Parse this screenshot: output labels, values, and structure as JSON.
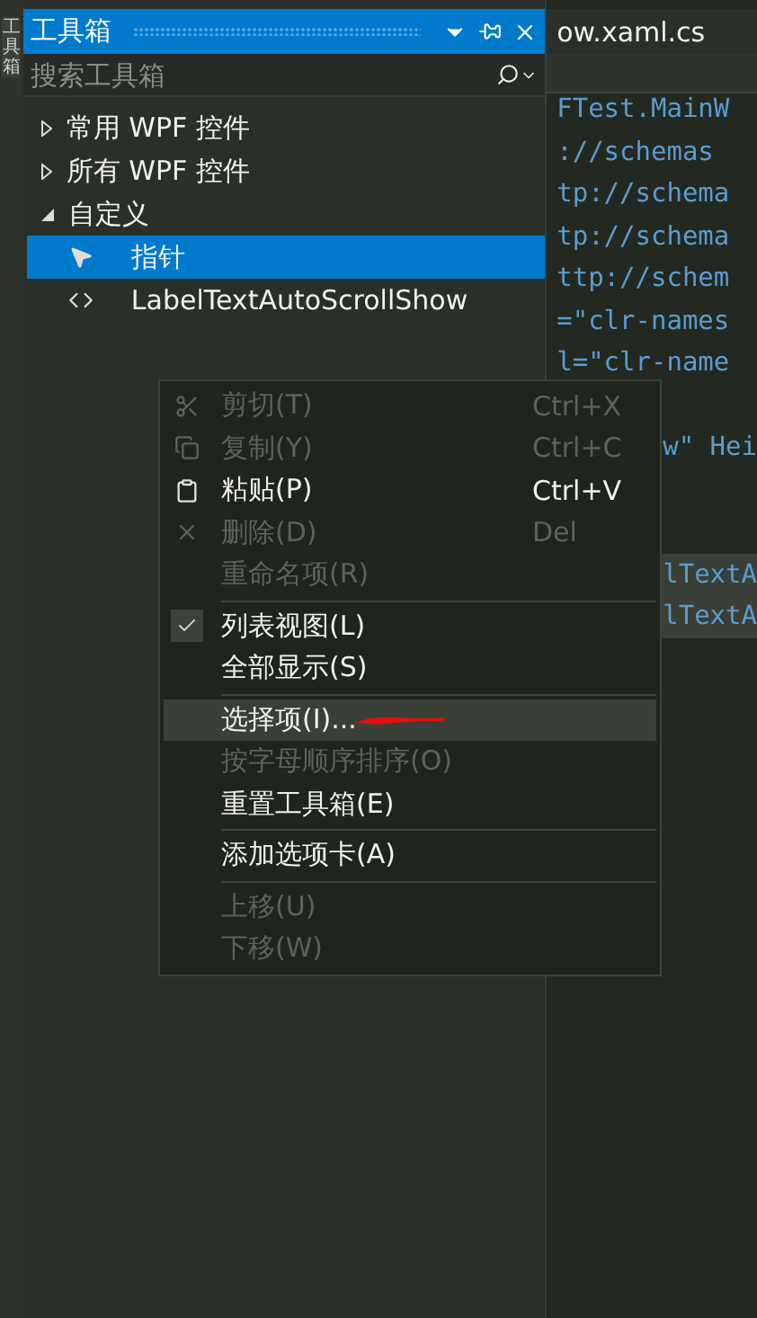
{
  "side_tab": {
    "label": "工具箱"
  },
  "toolbox": {
    "title": "工具箱",
    "search": {
      "placeholder": "搜索工具箱"
    },
    "tree": [
      {
        "label": "常用 WPF 控件",
        "expanded": false
      },
      {
        "label": "所有 WPF 控件",
        "expanded": false
      },
      {
        "label": "自定义",
        "expanded": true,
        "children": [
          {
            "label": "指针",
            "kind": "pointer",
            "selected": true
          },
          {
            "label": "LabelTextAutoScrollShow",
            "kind": "control",
            "selected": false
          }
        ]
      }
    ]
  },
  "editor": {
    "tab": "ow.xaml.cs",
    "lines": [
      "FTest.MainW",
      "://schemas",
      "tp://schema",
      "tp://schema",
      "ttp://schem",
      "=\"clr-names",
      "l=\"clr-name"
    ],
    "lines_beside_menu": [
      {
        "text": "w\" Hei",
        "highlighted": false
      },
      {
        "text": "lTextA",
        "highlighted": true
      },
      {
        "text": "lTextA",
        "highlighted": true
      }
    ]
  },
  "context_menu": [
    {
      "kind": "cut",
      "label": "剪切(T)",
      "shortcut": "Ctrl+X",
      "disabled": true,
      "checked": false,
      "selected": false,
      "scribbled": false
    },
    {
      "kind": "copy",
      "label": "复制(Y)",
      "shortcut": "Ctrl+C",
      "disabled": true,
      "checked": false,
      "selected": false,
      "scribbled": false
    },
    {
      "kind": "paste",
      "label": "粘贴(P)",
      "shortcut": "Ctrl+V",
      "disabled": false,
      "checked": false,
      "selected": false,
      "scribbled": false
    },
    {
      "kind": "delete",
      "label": "删除(D)",
      "shortcut": "Del",
      "disabled": true,
      "checked": false,
      "selected": false,
      "scribbled": false
    },
    {
      "kind": "item",
      "label": "重命名项(R)",
      "disabled": true,
      "checked": false,
      "selected": false,
      "scribbled": false
    },
    {
      "kind": "separator"
    },
    {
      "kind": "item",
      "label": "列表视图(L)",
      "disabled": false,
      "checked": true,
      "selected": false,
      "scribbled": false
    },
    {
      "kind": "item",
      "label": "全部显示(S)",
      "disabled": false,
      "checked": false,
      "selected": false,
      "scribbled": false
    },
    {
      "kind": "separator"
    },
    {
      "kind": "item",
      "label": "选择项(I)...",
      "disabled": false,
      "checked": false,
      "selected": true,
      "scribbled": true
    },
    {
      "kind": "item",
      "label": "按字母顺序排序(O)",
      "disabled": true,
      "checked": false,
      "selected": false,
      "scribbled": false
    },
    {
      "kind": "item",
      "label": "重置工具箱(E)",
      "disabled": false,
      "checked": false,
      "selected": false,
      "scribbled": false
    },
    {
      "kind": "separator"
    },
    {
      "kind": "item",
      "label": "添加选项卡(A)",
      "disabled": false,
      "checked": false,
      "selected": false,
      "scribbled": false
    },
    {
      "kind": "separator"
    },
    {
      "kind": "item",
      "label": "上移(U)",
      "disabled": true,
      "checked": false,
      "selected": false,
      "scribbled": false
    },
    {
      "kind": "item",
      "label": "下移(W)",
      "disabled": true,
      "checked": false,
      "selected": false,
      "scribbled": false
    }
  ]
}
